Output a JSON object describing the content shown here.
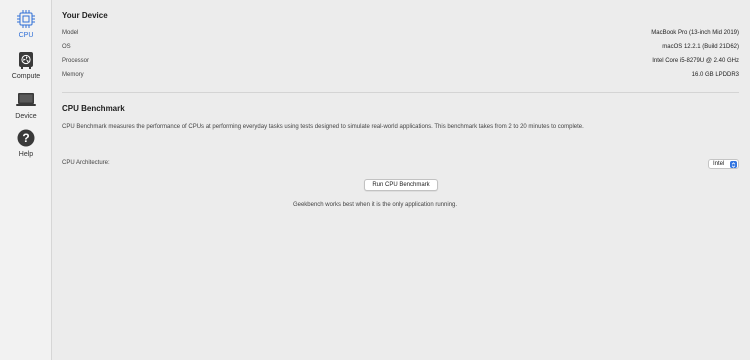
{
  "sidebar": {
    "items": [
      {
        "label": "CPU",
        "icon": "cpu-icon",
        "active": true
      },
      {
        "label": "Compute",
        "icon": "gpu-icon",
        "active": false
      },
      {
        "label": "Device",
        "icon": "laptop-icon",
        "active": false
      },
      {
        "label": "Help",
        "icon": "help-icon",
        "active": false
      }
    ]
  },
  "device": {
    "title": "Your Device",
    "rows": [
      {
        "label": "Model",
        "value": "MacBook Pro (13-inch Mid 2019)"
      },
      {
        "label": "OS",
        "value": "macOS 12.2.1 (Build 21D62)"
      },
      {
        "label": "Processor",
        "value": "Intel Core i5-8279U @ 2.40 GHz"
      },
      {
        "label": "Memory",
        "value": "16.0 GB LPDDR3"
      }
    ]
  },
  "benchmark": {
    "title": "CPU Benchmark",
    "description": "CPU Benchmark measures the performance of CPUs at performing everyday tasks using tests designed to simulate real-world applications. This benchmark takes from 2 to 20 minutes to complete.",
    "arch_label": "CPU Architecture:",
    "arch_value": "Intel",
    "run_button": "Run CPU Benchmark",
    "footnote": "Geekbench works best when it is the only application running."
  },
  "colors": {
    "accent": "#2f6fd6",
    "stepper": "#2f73e0",
    "background": "#ececec",
    "sidebar": "#f2f2f2"
  }
}
